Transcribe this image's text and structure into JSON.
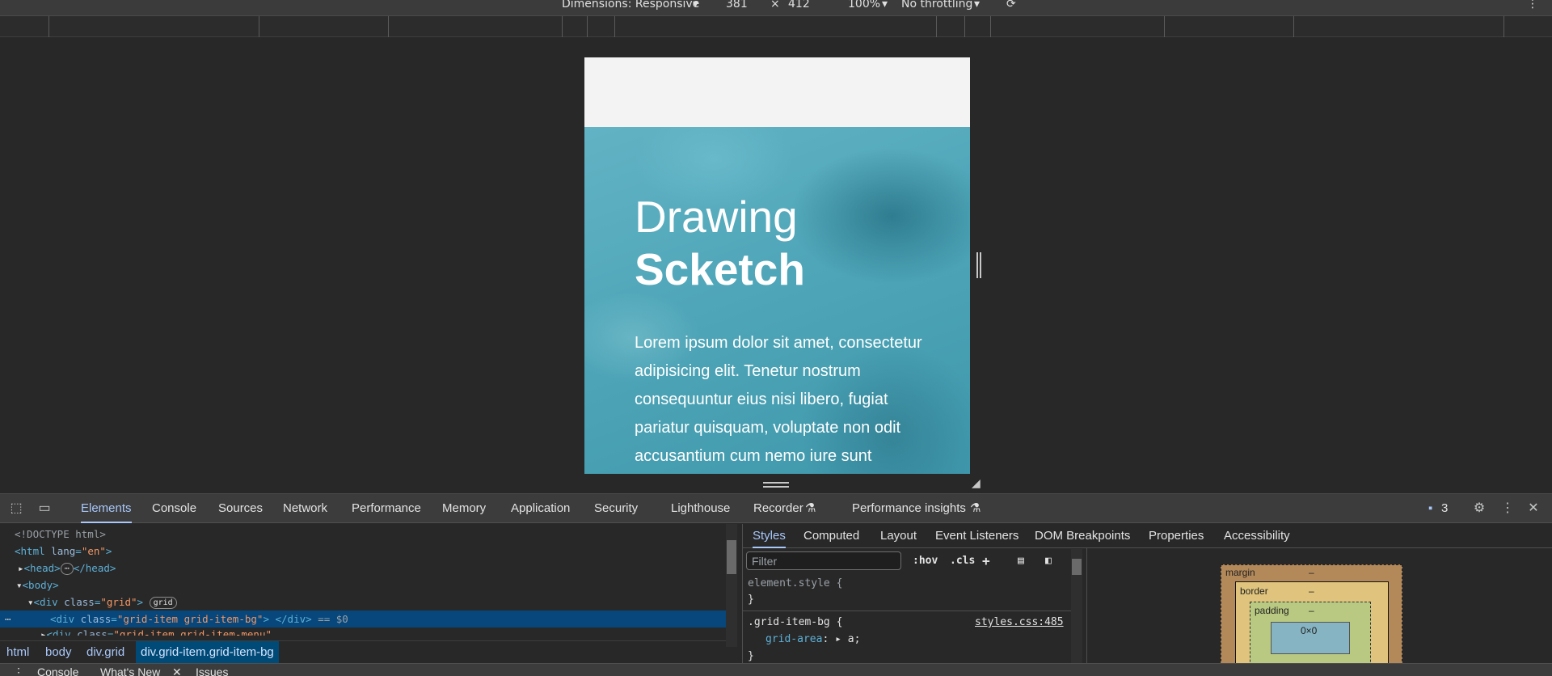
{
  "device_toolbar": {
    "dimensions_label": "Dimensions: Responsive",
    "width": "381",
    "times": "×",
    "height": "412",
    "zoom": "100%",
    "throttling": "No throttling"
  },
  "page": {
    "title_line1": "Drawing",
    "title_line2": "Scketch",
    "paragraph": "Lorem ipsum dolor sit amet, consectetur adipisicing elit. Tenetur nostrum consequuntur eius nisi libero, fugiat pariatur quisquam, voluptate non odit accusantium cum nemo iure sunt"
  },
  "devtools": {
    "tabs": [
      "Elements",
      "Console",
      "Sources",
      "Network",
      "Performance",
      "Memory",
      "Application",
      "Security",
      "Lighthouse",
      "Recorder",
      "Performance insights"
    ],
    "active_tab": "Elements",
    "issues_count": "3",
    "dom": {
      "doctype": "<!DOCTYPE html>",
      "html_open": "<html",
      "html_attr": "lang",
      "html_val": "\"en\"",
      "head": "<head>",
      "head_close": "</head>",
      "body": "<body>",
      "div_grid_open": "<div",
      "div_grid_attr": "class",
      "div_grid_val": "\"grid\"",
      "grid_badge": "grid",
      "div_item_attr": "class",
      "div_item_val": "\"grid-item grid-item-bg\"",
      "div_close": "</div>",
      "eq0": "== $0",
      "next_val": "\"grid-item grid-item-menu\""
    },
    "breadcrumbs": [
      "html",
      "body",
      "div.grid",
      "div.grid-item.grid-item-bg"
    ],
    "styles": {
      "sub_tabs": [
        "Styles",
        "Computed",
        "Layout",
        "Event Listeners",
        "DOM Breakpoints",
        "Properties",
        "Accessibility"
      ],
      "filter_placeholder": "Filter",
      "hov": ":hov",
      "cls": ".cls",
      "element_style": "element.style {",
      "close_brace": "}",
      "rule_selector": ".grid-item-bg {",
      "rule_source": "styles.css:485",
      "rule_prop": "grid-area",
      "rule_val": "a;"
    },
    "box_model": {
      "margin": "margin",
      "border": "border",
      "padding": "padding",
      "content": "0×0",
      "dash": "–"
    },
    "drawer_tabs": [
      "Console",
      "What's New",
      "Issues"
    ]
  }
}
